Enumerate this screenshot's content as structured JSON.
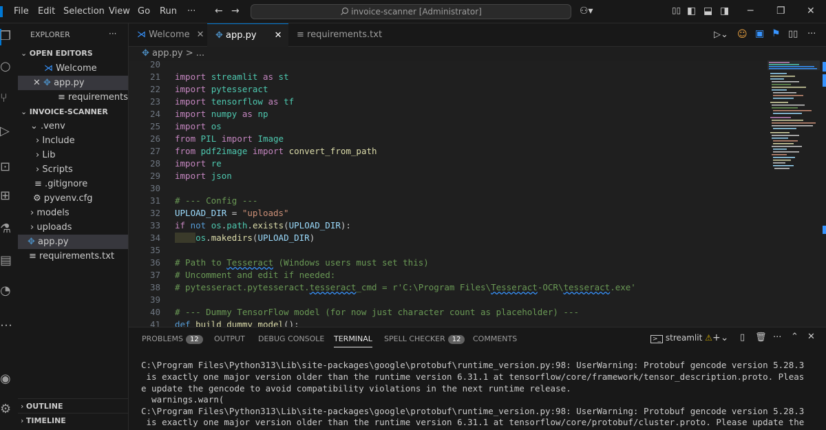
{
  "titlebar": {
    "menu": [
      "File",
      "Edit",
      "Selection",
      "View",
      "Go",
      "Run",
      "···"
    ],
    "command_center": "invoice-scanner [Administrator]"
  },
  "sidebar": {
    "title": "EXPLORER",
    "open_editors_header": "OPEN EDITORS",
    "open_editors": [
      "Welcome",
      "app.py",
      "requirements.txt"
    ],
    "project_header": "INVOICE-SCANNER",
    "tree": [
      ".venv",
      "Include",
      "Lib",
      "Scripts",
      ".gitignore",
      "pyvenv.cfg",
      "models",
      "uploads",
      "app.py",
      "requirements.txt"
    ],
    "outline": "OUTLINE",
    "timeline": "TIMELINE"
  },
  "tabs": [
    "Welcome",
    "app.py",
    "requirements.txt"
  ],
  "breadcrumb": "app.py > ...",
  "editor": {
    "line_numbers": [
      "20",
      "21",
      "22",
      "23",
      "24",
      "25",
      "26",
      "27",
      "28",
      "29",
      "30",
      "31",
      "32",
      "33",
      "34",
      "35",
      "36",
      "37",
      "38",
      "39",
      "40",
      "41"
    ]
  },
  "panel": {
    "tabs": {
      "problems": "PROBLEMS",
      "problems_count": "12",
      "output": "OUTPUT",
      "debug": "DEBUG CONSOLE",
      "terminal": "TERMINAL",
      "spell": "SPELL CHECKER",
      "spell_count": "12",
      "comments": "COMMENTS"
    },
    "terminal_name": "streamlit",
    "terminal_lines": [
      "C:\\Program Files\\Python313\\Lib\\site-packages\\google\\protobuf\\runtime_version.py:98: UserWarning: Protobuf gencode version 5.28.3",
      " is exactly one major version older than the runtime version 6.31.1 at tensorflow/core/framework/tensor_description.proto. Pleas",
      "e update the gencode to avoid compatibility violations in the next runtime release.",
      "  warnings.warn(",
      "C:\\Program Files\\Python313\\Lib\\site-packages\\google\\protobuf\\runtime_version.py:98: UserWarning: Protobuf gencode version 5.28.3",
      " is exactly one major version older than the runtime version 6.31.1 at tensorflow/core/protobuf/cluster.proto. Please update the"
    ]
  }
}
